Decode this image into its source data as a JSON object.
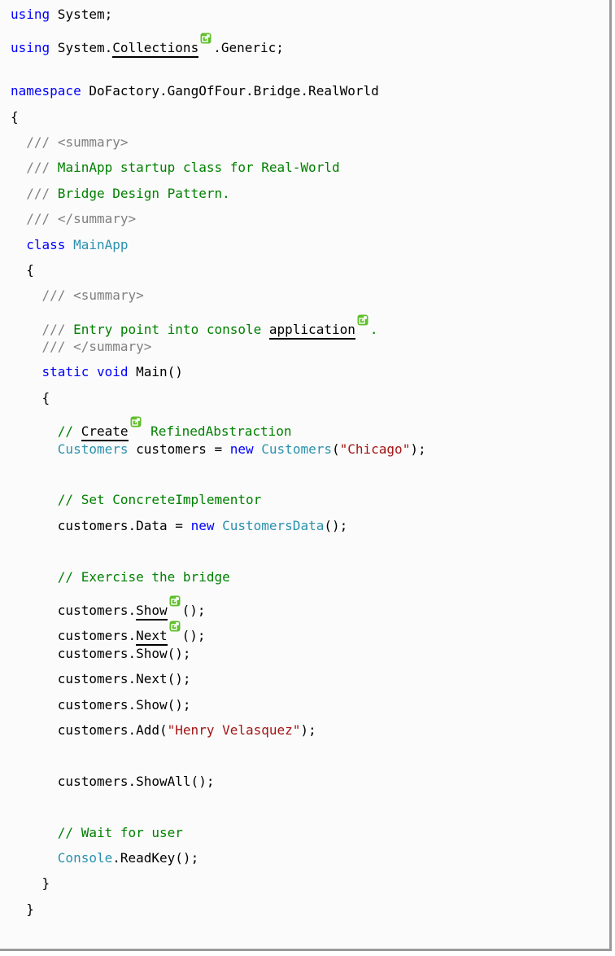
{
  "code_lines": [
    {
      "parts": [
        {
          "t": "using",
          "c": "kw"
        },
        {
          "t": " System;"
        }
      ]
    },
    {
      "parts": [
        {
          "t": "using",
          "c": "kw"
        },
        {
          "t": " System."
        },
        {
          "t": "Collections",
          "link": true
        },
        {
          "t": ".Generic;"
        }
      ]
    },
    {
      "parts": []
    },
    {
      "parts": [
        {
          "t": "namespace",
          "c": "kw"
        },
        {
          "t": " DoFactory.GangOfFour.Bridge.RealWorld"
        }
      ]
    },
    {
      "parts": [
        {
          "t": "{"
        }
      ]
    },
    {
      "parts": [
        {
          "t": "  "
        },
        {
          "t": "///",
          "c": "doc"
        },
        {
          "t": " ",
          "c": "cm"
        },
        {
          "t": "<summary>",
          "c": "doc"
        }
      ]
    },
    {
      "parts": [
        {
          "t": "  "
        },
        {
          "t": "///",
          "c": "doc"
        },
        {
          "t": " MainApp startup class for Real-World",
          "c": "cm"
        }
      ]
    },
    {
      "parts": [
        {
          "t": "  "
        },
        {
          "t": "///",
          "c": "doc"
        },
        {
          "t": " Bridge Design Pattern.",
          "c": "cm"
        }
      ]
    },
    {
      "parts": [
        {
          "t": "  "
        },
        {
          "t": "///",
          "c": "doc"
        },
        {
          "t": " ",
          "c": "cm"
        },
        {
          "t": "</summary>",
          "c": "doc"
        }
      ]
    },
    {
      "parts": [
        {
          "t": "  "
        },
        {
          "t": "class",
          "c": "kw"
        },
        {
          "t": " "
        },
        {
          "t": "MainApp",
          "c": "typ"
        }
      ]
    },
    {
      "parts": [
        {
          "t": "  {"
        }
      ]
    },
    {
      "parts": [
        {
          "t": "    "
        },
        {
          "t": "///",
          "c": "doc"
        },
        {
          "t": " ",
          "c": "cm"
        },
        {
          "t": "<summary>",
          "c": "doc"
        }
      ]
    },
    {
      "parts": [
        {
          "t": "    "
        },
        {
          "t": "///",
          "c": "doc"
        },
        {
          "t": " Entry point into console ",
          "c": "cm"
        },
        {
          "t": "application",
          "link": true
        },
        {
          "t": ".",
          "c": "cm"
        }
      ]
    },
    {
      "parts": [
        {
          "t": "    "
        },
        {
          "t": "///",
          "c": "doc"
        },
        {
          "t": " ",
          "c": "cm"
        },
        {
          "t": "</summary>",
          "c": "doc"
        }
      ]
    },
    {
      "parts": [
        {
          "t": "    "
        },
        {
          "t": "static",
          "c": "kw"
        },
        {
          "t": " "
        },
        {
          "t": "void",
          "c": "kw"
        },
        {
          "t": " Main()"
        }
      ]
    },
    {
      "parts": [
        {
          "t": "    {"
        }
      ]
    },
    {
      "parts": [
        {
          "t": "      "
        },
        {
          "t": "// ",
          "c": "cm"
        },
        {
          "t": "Create",
          "link": true
        },
        {
          "t": " RefinedAbstraction",
          "c": "cm"
        }
      ]
    },
    {
      "parts": [
        {
          "t": "      "
        },
        {
          "t": "Customers",
          "c": "typ"
        },
        {
          "t": " customers = "
        },
        {
          "t": "new",
          "c": "kw"
        },
        {
          "t": " "
        },
        {
          "t": "Customers",
          "c": "typ"
        },
        {
          "t": "("
        },
        {
          "t": "\"Chicago\"",
          "c": "str"
        },
        {
          "t": ");"
        }
      ]
    },
    {
      "parts": []
    },
    {
      "parts": [
        {
          "t": "      "
        },
        {
          "t": "// Set ConcreteImplementor",
          "c": "cm"
        }
      ]
    },
    {
      "parts": [
        {
          "t": "      customers.Data = "
        },
        {
          "t": "new",
          "c": "kw"
        },
        {
          "t": " "
        },
        {
          "t": "CustomersData",
          "c": "typ"
        },
        {
          "t": "();"
        }
      ]
    },
    {
      "parts": []
    },
    {
      "parts": [
        {
          "t": "      "
        },
        {
          "t": "// Exercise the bridge",
          "c": "cm"
        }
      ]
    },
    {
      "parts": [
        {
          "t": "      customers."
        },
        {
          "t": "Show",
          "link": true
        },
        {
          "t": "();"
        }
      ]
    },
    {
      "parts": [
        {
          "t": "      customers."
        },
        {
          "t": "Next",
          "link": true
        },
        {
          "t": "();"
        }
      ]
    },
    {
      "parts": [
        {
          "t": "      customers.Show();"
        }
      ]
    },
    {
      "parts": [
        {
          "t": "      customers.Next();"
        }
      ]
    },
    {
      "parts": [
        {
          "t": "      customers.Show();"
        }
      ]
    },
    {
      "parts": [
        {
          "t": "      customers.Add("
        },
        {
          "t": "\"Henry Velasquez\"",
          "c": "str"
        },
        {
          "t": ");"
        }
      ]
    },
    {
      "parts": []
    },
    {
      "parts": [
        {
          "t": "      customers.ShowAll();"
        }
      ]
    },
    {
      "parts": []
    },
    {
      "parts": [
        {
          "t": "      "
        },
        {
          "t": "// Wait for user",
          "c": "cm"
        }
      ]
    },
    {
      "parts": [
        {
          "t": "      "
        },
        {
          "t": "Console",
          "c": "typ"
        },
        {
          "t": ".ReadKey();"
        }
      ]
    },
    {
      "parts": [
        {
          "t": "    }"
        }
      ]
    },
    {
      "parts": [
        {
          "t": "  }"
        }
      ]
    }
  ],
  "link_icon": "external-link-icon",
  "colors": {
    "keyword": "#0000ff",
    "type": "#2b91af",
    "comment": "#008000",
    "doc_tag": "#808080",
    "string": "#a31515",
    "link_icon": "#5fbf2a"
  }
}
